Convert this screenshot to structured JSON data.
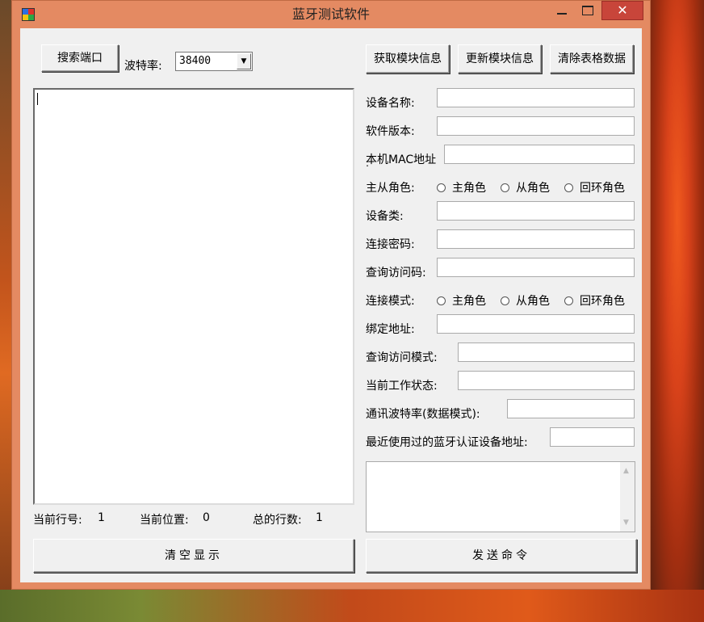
{
  "window": {
    "title": "蓝牙测试软件",
    "controls": {
      "minimize": "minimize-icon",
      "maximize": "maximize-icon",
      "close": "✕"
    }
  },
  "toolbar": {
    "search_port": "搜索端口",
    "baud_label": "波特率:",
    "baud_value": "38400",
    "get_module_info": "获取模块信息",
    "update_module_info": "更新模块信息",
    "clear_table": "清除表格数据"
  },
  "fields": {
    "device_name": {
      "label": "设备名称:",
      "value": ""
    },
    "software_version": {
      "label": "软件版本:",
      "value": ""
    },
    "mac_address": {
      "label": "本机MAC地址",
      "suffix": ":",
      "value": ""
    },
    "role": {
      "label": "主从角色:",
      "options": [
        "主角色",
        "从角色",
        "回环角色"
      ]
    },
    "device_class": {
      "label": "设备类:",
      "value": ""
    },
    "pin_code": {
      "label": "连接密码:",
      "value": ""
    },
    "inquiry_access_code": {
      "label": "查询访问码:",
      "value": ""
    },
    "connect_mode": {
      "label": "连接模式:",
      "options": [
        "主角色",
        "从角色",
        "回环角色"
      ]
    },
    "bind_address": {
      "label": "绑定地址:",
      "value": ""
    },
    "inquiry_access_mode": {
      "label": "查询访问模式:",
      "value": ""
    },
    "current_state": {
      "label": "当前工作状态:",
      "value": ""
    },
    "uart_baud": {
      "label": "通讯波特率(数据模式):",
      "value": ""
    },
    "recent_address": {
      "label": "最近使用过的蓝牙认证设备地址:",
      "value": ""
    }
  },
  "status": {
    "current_line_label": "当前行号:",
    "current_line": "1",
    "current_pos_label": "当前位置:",
    "current_pos": "0",
    "total_lines_label": "总的行数:",
    "total_lines": "1"
  },
  "actions": {
    "clear_display": "清空显示",
    "send_command": "发送命令"
  }
}
